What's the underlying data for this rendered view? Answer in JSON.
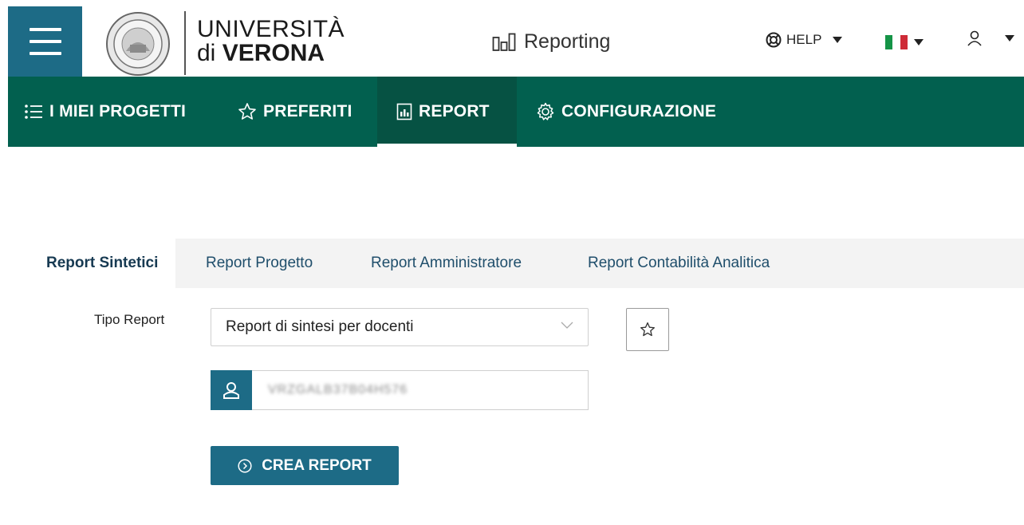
{
  "header": {
    "university_line1": "UNIVERSITÀ",
    "university_line2_prefix": "di",
    "university_line2_bold": "VERONA",
    "app_title": "Reporting",
    "help_label": "HELP",
    "language_flag": "it-flag",
    "user_icon": "user-icon"
  },
  "navbar": {
    "items": [
      {
        "label": "I MIEI PROGETTI",
        "icon": "list-icon"
      },
      {
        "label": "PREFERITI",
        "icon": "star-icon"
      },
      {
        "label": "REPORT",
        "icon": "report-icon",
        "active": true
      },
      {
        "label": "CONFIGURAZIONE",
        "icon": "gear-icon"
      }
    ]
  },
  "tabs": [
    {
      "label": "Report Sintetici",
      "active": true
    },
    {
      "label": "Report Progetto"
    },
    {
      "label": "Report Amministratore"
    },
    {
      "label": "Report Contabilità Analitica"
    }
  ],
  "form": {
    "tipo_label": "Tipo Report",
    "tipo_value": "Report di sintesi per docenti",
    "user_field_value": "VRZGALB37B04H576",
    "crea_button": "CREA REPORT"
  },
  "colors": {
    "brand_blue": "#1d6b86",
    "nav_green": "#02604f",
    "nav_active": "#065243"
  }
}
